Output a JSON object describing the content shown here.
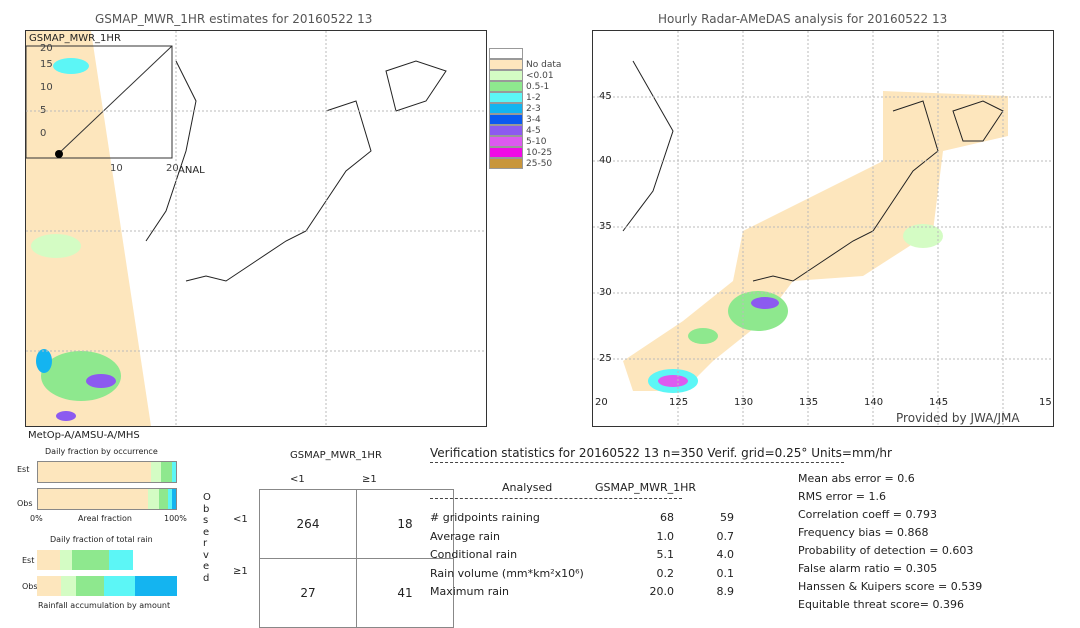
{
  "left_map": {
    "title": "GSMAP_MWR_1HR estimates for 20160522 13",
    "inset_label": "GSMAP_MWR_1HR",
    "inset_yticks": [
      "20",
      "15",
      "10",
      "5",
      "0"
    ],
    "inset_xticks": [
      "10",
      "20"
    ],
    "anal_label": "ANAL",
    "satellite": "MetOp-A/AMSU-A/MHS"
  },
  "legend": {
    "items": [
      {
        "label": "",
        "color": "#ffffff"
      },
      {
        "label": "No data",
        "color": "#fde6bd"
      },
      {
        "label": "<0.01",
        "color": "#d4fcc4"
      },
      {
        "label": "0.5-1",
        "color": "#8ee88e"
      },
      {
        "label": "1-2",
        "color": "#5cf6f6"
      },
      {
        "label": "2-3",
        "color": "#14b4f0"
      },
      {
        "label": "3-4",
        "color": "#0a5af0"
      },
      {
        "label": "4-5",
        "color": "#8c5af0"
      },
      {
        "label": "5-10",
        "color": "#dc5af0"
      },
      {
        "label": "10-25",
        "color": "#f00ae6"
      },
      {
        "label": "25-50",
        "color": "#c8963c"
      }
    ]
  },
  "right_map": {
    "title": "Hourly Radar-AMeDAS analysis for 20160522 13",
    "lat_ticks": [
      "45",
      "40",
      "35",
      "30",
      "25"
    ],
    "lon_ticks": [
      "20",
      "125",
      "130",
      "135",
      "140",
      "145",
      "15"
    ],
    "credit": "Provided by JWA/JMA"
  },
  "fractions": {
    "occurrence_title": "Daily fraction by occurrence",
    "est": "Est",
    "obs": "Obs",
    "pct0": "0%",
    "areal": "Areal fraction",
    "pct100": "100%",
    "total_title": "Daily fraction of total rain",
    "accum_title": "Rainfall accumulation by amount"
  },
  "contingency": {
    "title": "GSMAP_MWR_1HR",
    "col_lt": "<1",
    "col_ge": "≥1",
    "row_lt": "<1",
    "row_ge": "≥1",
    "observed": "Observed",
    "cells": [
      [
        "264",
        "18"
      ],
      [
        "27",
        "41"
      ]
    ]
  },
  "verification": {
    "header": "Verification statistics for 20160522 13  n=350  Verif. grid=0.25°  Units=mm/hr",
    "col_analysed": "Analysed",
    "col_gsmap": "GSMAP_MWR_1HR",
    "rows": [
      {
        "label": "# gridpoints raining",
        "a": "68",
        "g": "59"
      },
      {
        "label": "Average rain",
        "a": "1.0",
        "g": "0.7"
      },
      {
        "label": "Conditional rain",
        "a": "5.1",
        "g": "4.0"
      },
      {
        "label": "Rain volume (mm*km²x10⁶)",
        "a": "0.2",
        "g": "0.1"
      },
      {
        "label": "Maximum rain",
        "a": "20.0",
        "g": "8.9"
      }
    ],
    "scores": [
      "Mean abs error = 0.6",
      "RMS error = 1.6",
      "Correlation coeff = 0.793",
      "Frequency bias = 0.868",
      "Probability of detection = 0.603",
      "False alarm ratio = 0.305",
      "Hanssen & Kuipers score = 0.539",
      "Equitable threat score= 0.396"
    ]
  }
}
